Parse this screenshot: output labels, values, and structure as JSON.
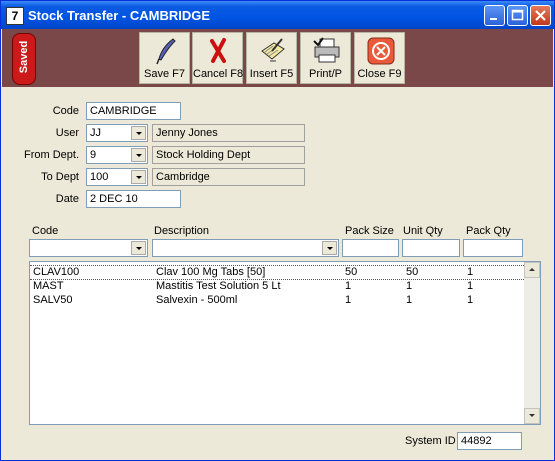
{
  "window": {
    "title": "Stock Transfer - CAMBRIDGE",
    "app_icon_text": "7"
  },
  "toolbar": {
    "saved_badge": "Saved",
    "buttons": {
      "save": "Save F7",
      "cancel": "Cancel F8",
      "insert": "Insert F5",
      "print": "Print/P",
      "close": "Close F9"
    }
  },
  "form": {
    "code": {
      "label": "Code",
      "value": "CAMBRIDGE"
    },
    "user": {
      "label": "User",
      "value": "JJ",
      "display": "Jenny Jones"
    },
    "from_dept": {
      "label": "From Dept.",
      "value": "9",
      "display": "Stock Holding Dept"
    },
    "to_dept": {
      "label": "To Dept",
      "value": "100",
      "display": "Cambridge"
    },
    "date": {
      "label": "Date",
      "value": "2 DEC 10"
    }
  },
  "grid": {
    "columns": {
      "code": "Code",
      "description": "Description",
      "pack_size": "Pack Size",
      "unit_qty": "Unit Qty",
      "pack_qty": "Pack Qty"
    },
    "rows": [
      {
        "code": "CLAV100",
        "description": "Clav 100 Mg Tabs [50]",
        "pack_size": "50",
        "unit_qty": "50",
        "pack_qty": "1"
      },
      {
        "code": "MAST",
        "description": "Mastitis Test Solution 5 Lt",
        "pack_size": "1",
        "unit_qty": "1",
        "pack_qty": "1"
      },
      {
        "code": "SALV50",
        "description": "Salvexin - 500ml",
        "pack_size": "1",
        "unit_qty": "1",
        "pack_qty": "1"
      }
    ]
  },
  "footer": {
    "system_id_label": "System ID",
    "system_id": "44892"
  },
  "colors": {
    "toolbar_bg": "#7a4848",
    "saved_badge": "#cc1a1a",
    "titlebar": "#0054e3",
    "window_bg": "#ece9d8"
  }
}
